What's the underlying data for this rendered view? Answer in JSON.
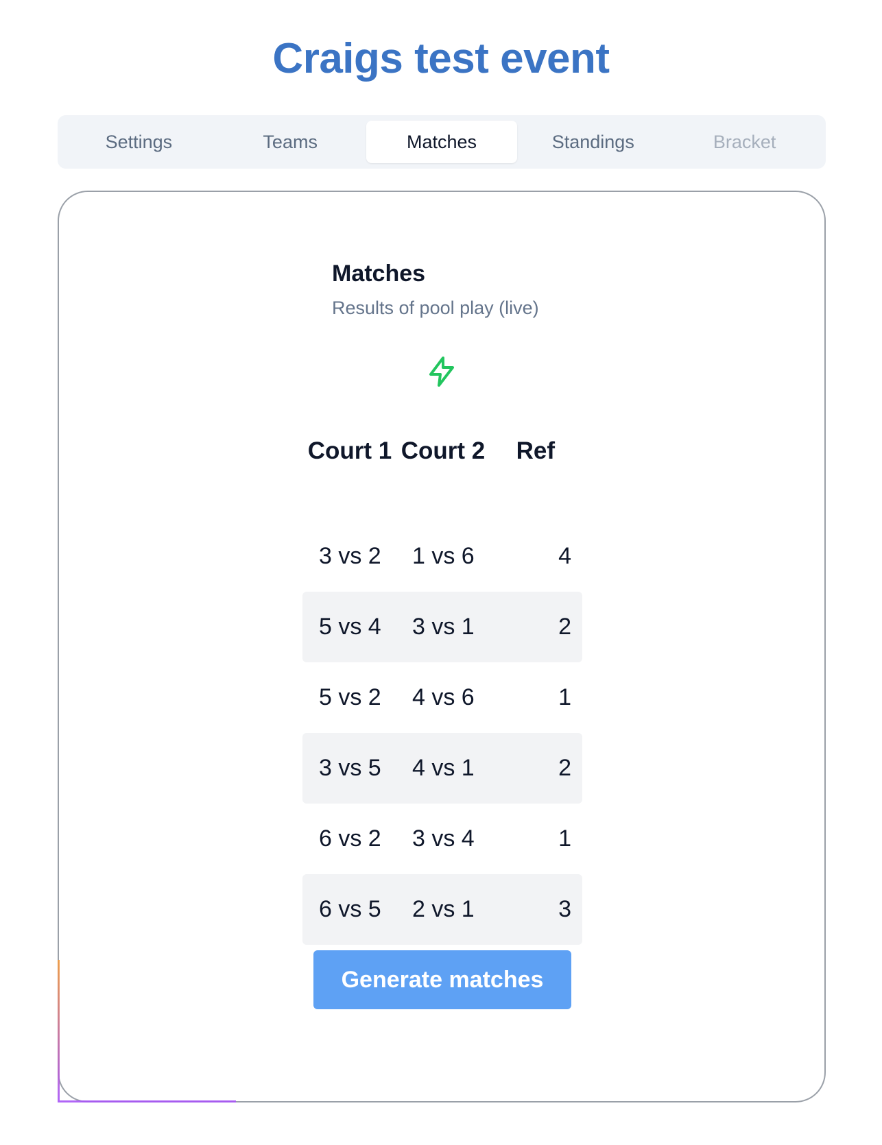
{
  "page": {
    "title": "Craigs test event"
  },
  "tabs": [
    {
      "label": "Settings",
      "state": "normal"
    },
    {
      "label": "Teams",
      "state": "normal"
    },
    {
      "label": "Matches",
      "state": "active"
    },
    {
      "label": "Standings",
      "state": "normal"
    },
    {
      "label": "Bracket",
      "state": "disabled"
    }
  ],
  "matches": {
    "heading": "Matches",
    "subheading": "Results of pool play (live)",
    "live_icon": "lightning-bolt-icon",
    "live_icon_color": "#22c55e",
    "columns": {
      "court1": "Court 1",
      "court2": "Court 2",
      "ref": "Ref"
    },
    "rows": [
      {
        "court1": "3 vs 2",
        "court2": "1 vs 6",
        "ref": "4"
      },
      {
        "court1": "5 vs 4",
        "court2": "3 vs 1",
        "ref": "2"
      },
      {
        "court1": "5 vs 2",
        "court2": "4 vs 6",
        "ref": "1"
      },
      {
        "court1": "3 vs 5",
        "court2": "4 vs 1",
        "ref": "2"
      },
      {
        "court1": "6 vs 2",
        "court2": "3 vs 4",
        "ref": "1"
      },
      {
        "court1": "6 vs 5",
        "court2": "2 vs 1",
        "ref": "3"
      }
    ],
    "generate_label": "Generate matches"
  },
  "colors": {
    "title": "#3b74c4",
    "button": "#5ea1f4",
    "row_alt": "#f2f3f5"
  }
}
